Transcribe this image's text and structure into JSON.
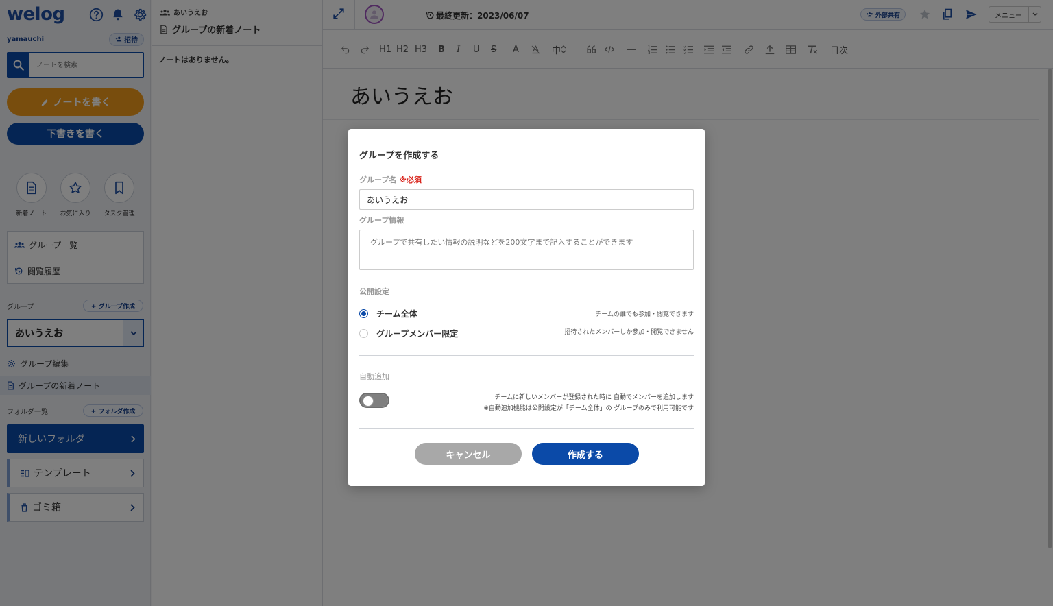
{
  "sidebar": {
    "logo": "welog",
    "user_name": "yamauchi",
    "invite_label": "招待",
    "search_placeholder": "ノートを検索",
    "write_note_label": "ノートを書く",
    "write_draft_label": "下書きを書く",
    "quick_links": [
      {
        "label": "新着ノート",
        "icon": "document-icon"
      },
      {
        "label": "お気に入り",
        "icon": "star-icon"
      },
      {
        "label": "タスク管理",
        "icon": "bookmark-icon"
      }
    ],
    "nav": [
      {
        "label": "グループ一覧",
        "icon": "group-icon"
      },
      {
        "label": "閲覧履歴",
        "icon": "history-icon"
      }
    ],
    "group_section_label": "グループ",
    "create_group_label": "+ グループ作成",
    "selected_group": "あいうえお",
    "group_edit_label": "グループ編集",
    "group_new_notes_label": "グループの新着ノート",
    "folder_section_label": "フォルダ一覧",
    "create_folder_label": "+ フォルダ作成",
    "folders": [
      {
        "label": "新しいフォルダ"
      },
      {
        "label": "テンプレート"
      },
      {
        "label": "ゴミ箱"
      }
    ]
  },
  "middle": {
    "breadcrumb": "あいうえお",
    "title": "グループの新着ノート",
    "empty_message": "ノートはありません。"
  },
  "editor": {
    "last_updated": "最終更新：2023/06/07",
    "share_label": "外部共有",
    "menu_label": "メニュー",
    "toolbar": {
      "h1": "H1",
      "h2": "H2",
      "h3": "H3",
      "bold": "B",
      "italic": "I",
      "underline": "U",
      "strike": "S",
      "font_color": "A",
      "size": "中",
      "toc": "目次"
    },
    "doc_title": "あいうえお"
  },
  "modal": {
    "title": "グループを作成する",
    "name_label": "グループ名",
    "required_label": "※必須",
    "name_value": "あいうえお",
    "info_label": "グループ情報",
    "info_placeholder": "グループで共有したい情報の説明などを200文字まで記入することができます",
    "visibility_label": "公開設定",
    "visibility_options": [
      {
        "label": "チーム全体",
        "desc": "チームの誰でも参加・閲覧できます",
        "selected": true
      },
      {
        "label": "グループメンバー限定",
        "desc": "招待されたメンバーしか参加・閲覧できません",
        "selected": false
      }
    ],
    "auto_add_label": "自動追加",
    "auto_add_enabled": false,
    "auto_add_desc_1": "チームに新しいメンバーが登録された時に 自動でメンバーを追加します",
    "auto_add_desc_2": "※自動追加機能は公開設定が「チーム全体」の グループのみで利用可能です",
    "cancel_label": "キャンセル",
    "create_label": "作成する"
  },
  "colors": {
    "brand_blue": "#0b4aa8",
    "write_orange": "#f09a1a",
    "required_red": "#d9241c"
  }
}
